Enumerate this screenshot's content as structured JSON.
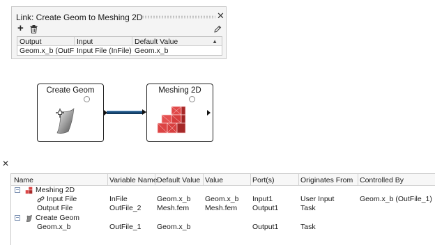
{
  "link_dialog": {
    "title": "Link: Create Geom to Meshing 2D",
    "close_glyph": "✕",
    "add_glyph": "+",
    "delete_icon": "trash-icon",
    "edit_icon": "pencil-icon",
    "columns": [
      "Output",
      "Input",
      "Default Value"
    ],
    "rows": [
      {
        "output": "Geom.x_b (OutFil...",
        "input": "Input File (InFile)",
        "default_value": "Geom.x_b"
      }
    ]
  },
  "canvas": {
    "nodes": [
      {
        "title": "Create Geom",
        "icon": "surface-patch-icon"
      },
      {
        "title": "Meshing 2D",
        "icon": "meshed-blocks-icon"
      }
    ],
    "connector_color": "#1a4b78"
  },
  "properties_panel": {
    "close_glyph": "✕",
    "columns": [
      "Name",
      "Variable Name",
      "Default Value",
      "Value",
      "Port(s)",
      "Originates From",
      "Controlled By"
    ],
    "groups": [
      {
        "name": "Meshing 2D",
        "expander": "⊟",
        "icon": "meshed-blocks-icon",
        "rows": [
          {
            "name": "Input File",
            "icon": "link-icon",
            "variable_name": "InFile",
            "default_value": "Geom.x_b",
            "value": "Geom.x_b",
            "ports": "Input1",
            "originates_from": "User Input",
            "controlled_by": "Geom.x_b (OutFile_1)"
          },
          {
            "name": "Output File",
            "variable_name": "OutFile_2",
            "default_value": "Mesh.fem",
            "value": "Mesh.fem",
            "ports": "Output1",
            "originates_from": "Task",
            "controlled_by": ""
          }
        ]
      },
      {
        "name": "Create Geom",
        "expander": "⊟",
        "icon": "surface-patch-icon",
        "rows": [
          {
            "name": "Geom.x_b",
            "variable_name": "OutFile_1",
            "default_value": "Geom.x_b",
            "value": "",
            "ports": "Output1",
            "originates_from": "Task",
            "controlled_by": ""
          }
        ]
      }
    ]
  }
}
